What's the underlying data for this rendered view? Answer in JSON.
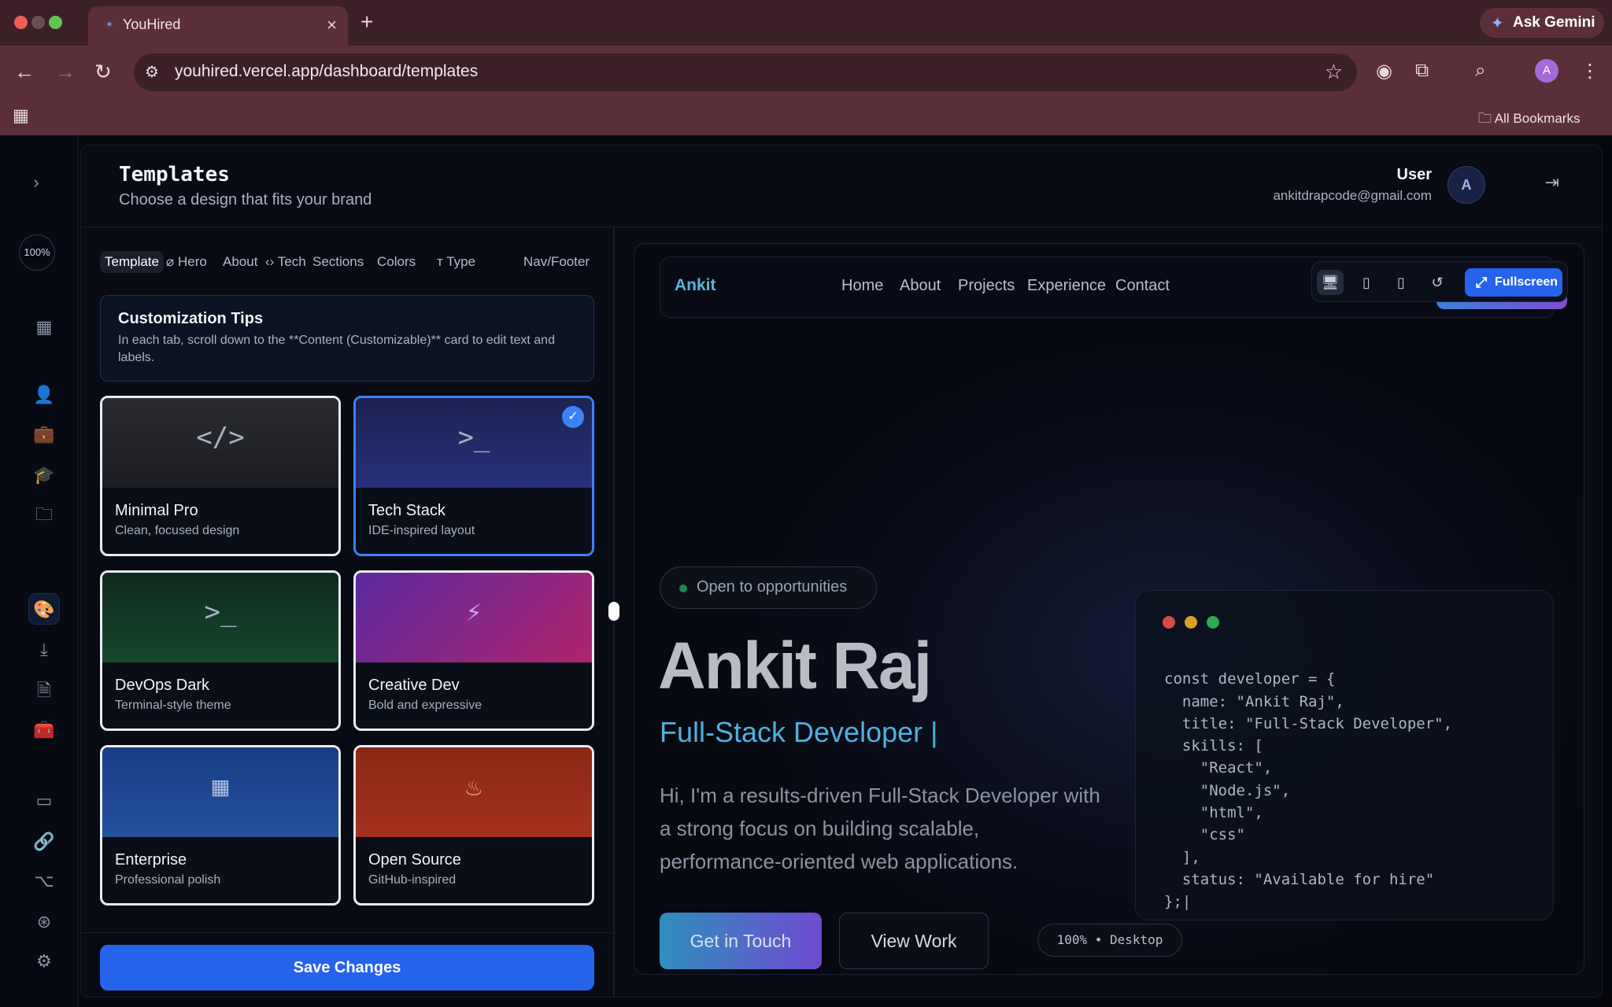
{
  "browser": {
    "tab_title": "YouHired",
    "url": "youhired.vercel.app/dashboard/templates",
    "ask_gemini": "Ask Gemini",
    "profile_initial": "A",
    "all_bookmarks": "All Bookmarks"
  },
  "rail": {
    "zoom": "100%"
  },
  "header": {
    "title": "Templates",
    "subtitle": "Choose a design that fits your brand",
    "user_name": "User",
    "user_email": "ankitdrapcode@gmail.com",
    "avatar_initial": "A"
  },
  "tabs": {
    "template": "Template",
    "hero": "Hero",
    "about": "About",
    "tech": "Tech",
    "sections": "Sections",
    "colors": "Colors",
    "type": "Type",
    "navfooter": "Nav/Footer"
  },
  "tips": {
    "title": "Customization Tips",
    "body": "In each tab, scroll down to the **Content (Customizable)** card to edit text and labels."
  },
  "templates": [
    {
      "name": "Minimal Pro",
      "desc": "Clean, focused design",
      "icon": "</>"
    },
    {
      "name": "Tech Stack",
      "desc": "IDE-inspired layout",
      "icon": ">_"
    },
    {
      "name": "DevOps Dark",
      "desc": "Terminal-style theme",
      "icon": ">_"
    },
    {
      "name": "Creative Dev",
      "desc": "Bold and expressive",
      "icon": "⚡"
    },
    {
      "name": "Enterprise",
      "desc": "Professional polish",
      "icon": "▦"
    },
    {
      "name": "Open Source",
      "desc": "GitHub-inspired",
      "icon": "♨"
    }
  ],
  "save_label": "Save Changes",
  "preview": {
    "brand": "Ankit",
    "nav": [
      "Home",
      "About",
      "Projects",
      "Experience",
      "Contact"
    ],
    "fullscreen": "Fullscreen",
    "badge": "Open to opportunities",
    "name": "Ankit Raj",
    "role": "Full-Stack Developer",
    "role_cursor": "|",
    "description": "Hi, I'm a results-driven Full-Stack Developer with a strong focus on building scalable, performance-oriented web applications.",
    "cta_primary": "Get in Touch",
    "cta_secondary": "View Work",
    "zoom_chip": "100% • Desktop",
    "code": [
      "const developer = {",
      "  name: \"Ankit Raj\",",
      "  title: \"Full-Stack Developer\",",
      "  skills: [",
      "    \"React\",",
      "    \"Node.js\",",
      "    \"html\",",
      "    \"css\"",
      "  ],",
      "  status: \"Available for hire\"",
      "};|"
    ]
  }
}
